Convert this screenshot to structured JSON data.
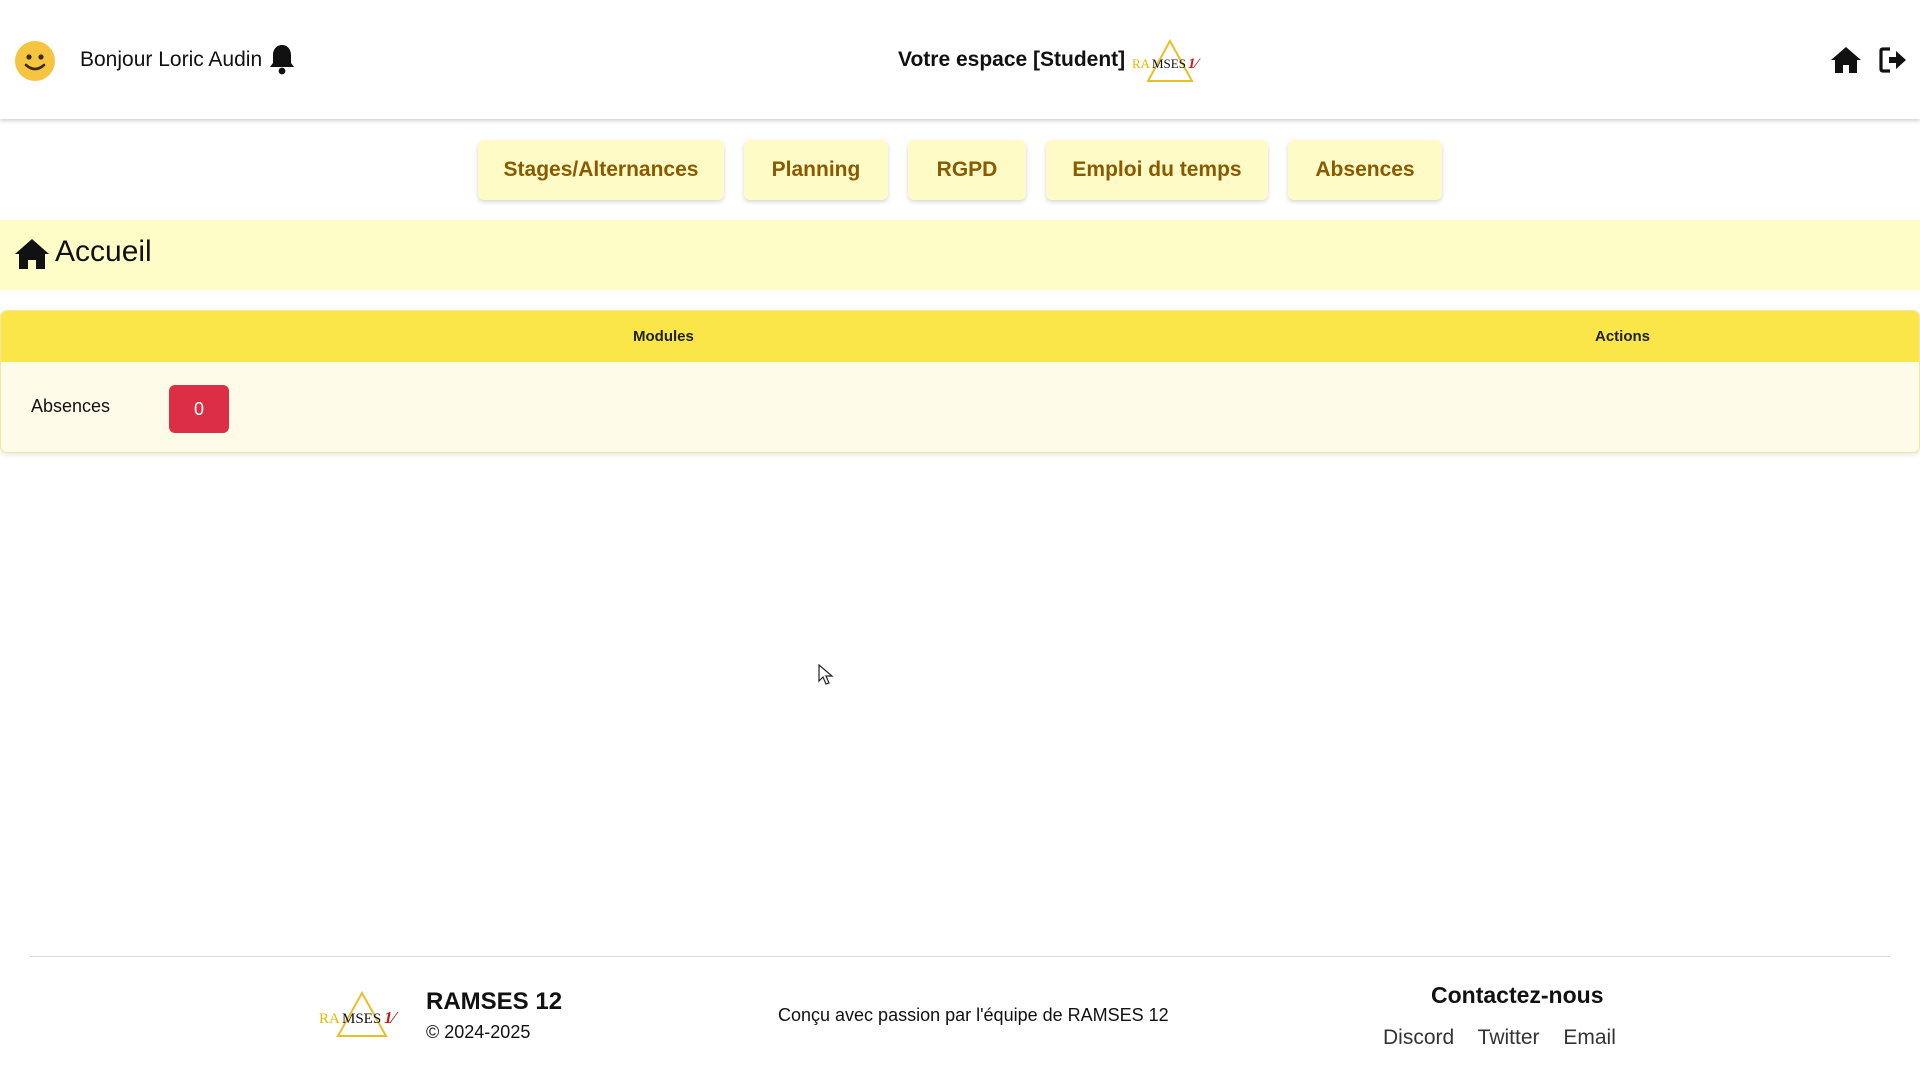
{
  "header": {
    "greeting": "Bonjour Loric Audin",
    "space_title": "Votre espace [Student]",
    "logo_text": "RAMSES12"
  },
  "nav": {
    "items": [
      {
        "label": "Stages/Alternances"
      },
      {
        "label": "Planning"
      },
      {
        "label": "RGPD"
      },
      {
        "label": "Emploi du temps"
      },
      {
        "label": "Absences"
      }
    ]
  },
  "page": {
    "title": "Accueil"
  },
  "table": {
    "columns": [
      "Modules",
      "Actions"
    ],
    "rows": [
      {
        "module": "Absences",
        "count": "0"
      }
    ]
  },
  "footer": {
    "brand": "RAMSES 12",
    "copyright": "© 2024-2025",
    "made_by": "Conçu avec passion par l'équipe de RAMSES 12",
    "contact_title": "Contactez-nous",
    "links": [
      "Discord",
      "Twitter",
      "Email"
    ]
  },
  "colors": {
    "nav_bg": "#fefbc6",
    "nav_text": "#8a5a00",
    "header_bg": "#fefcc7",
    "table_head": "#fbe64a",
    "badge": "#dc2f45"
  },
  "icons": [
    "smiley-icon",
    "bell-icon",
    "home-icon",
    "logout-icon",
    "cursor-icon"
  ]
}
